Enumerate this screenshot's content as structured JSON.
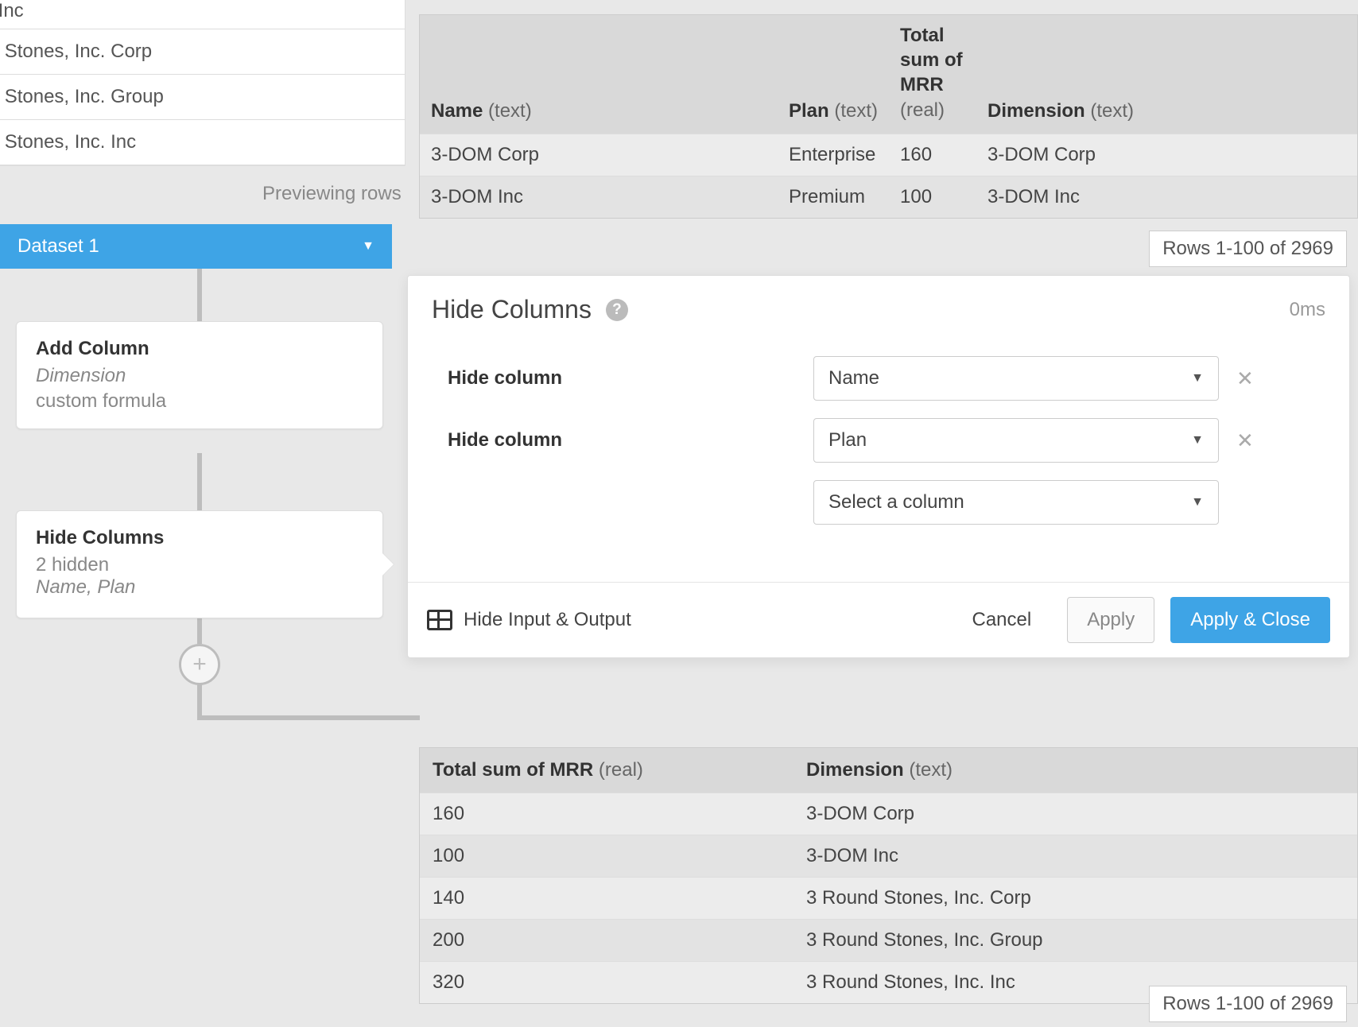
{
  "bg_rows": [
    "und Stones, Inc. Corp",
    "und Stones, Inc. Group",
    "und Stones, Inc. Inc"
  ],
  "previewing": "Previewing rows",
  "dataset_header": "Dataset 1",
  "flow": {
    "add_column": {
      "title": "Add Column",
      "sub1": "Dimension",
      "sub2": "custom formula"
    },
    "hide_columns": {
      "title": "Hide Columns",
      "sub1": "2 hidden",
      "sub2": "Name, Plan"
    }
  },
  "top_preview": {
    "headers": {
      "name": "Name",
      "name_t": "(text)",
      "plan": "Plan",
      "plan_t": "(text)",
      "mrr": "Total sum of MRR",
      "mrr_t": "(real)",
      "dimension": "Dimension",
      "dimension_t": "(text)"
    },
    "rows": [
      {
        "name": "3-DOM Corp",
        "plan": "Enterprise",
        "mrr": "160",
        "dimension": "3-DOM Corp"
      },
      {
        "name": "3-DOM Inc",
        "plan": "Premium",
        "mrr": "100",
        "dimension": "3-DOM Inc"
      }
    ],
    "rows_chip": "Rows 1-100 of 2969"
  },
  "modal": {
    "title": "Hide Columns",
    "timing": "0ms",
    "field_label": "Hide column",
    "selects": [
      {
        "value": "Name",
        "removable": true
      },
      {
        "value": "Plan",
        "removable": true
      },
      {
        "value": "Select a column",
        "removable": false
      }
    ],
    "footer": {
      "hide_io": "Hide Input & Output",
      "cancel": "Cancel",
      "apply": "Apply",
      "apply_close": "Apply & Close"
    }
  },
  "output": {
    "headers": {
      "mrr": "Total sum of MRR",
      "mrr_t": "(real)",
      "dimension": "Dimension",
      "dimension_t": "(text)"
    },
    "rows": [
      {
        "mrr": "160",
        "dimension": "3-DOM Corp"
      },
      {
        "mrr": "100",
        "dimension": "3-DOM Inc"
      },
      {
        "mrr": "140",
        "dimension": "3 Round Stones, Inc. Corp"
      },
      {
        "mrr": "200",
        "dimension": "3 Round Stones, Inc. Group"
      },
      {
        "mrr": "320",
        "dimension": "3 Round Stones, Inc. Inc"
      }
    ],
    "rows_chip": "Rows 1-100 of 2969"
  }
}
